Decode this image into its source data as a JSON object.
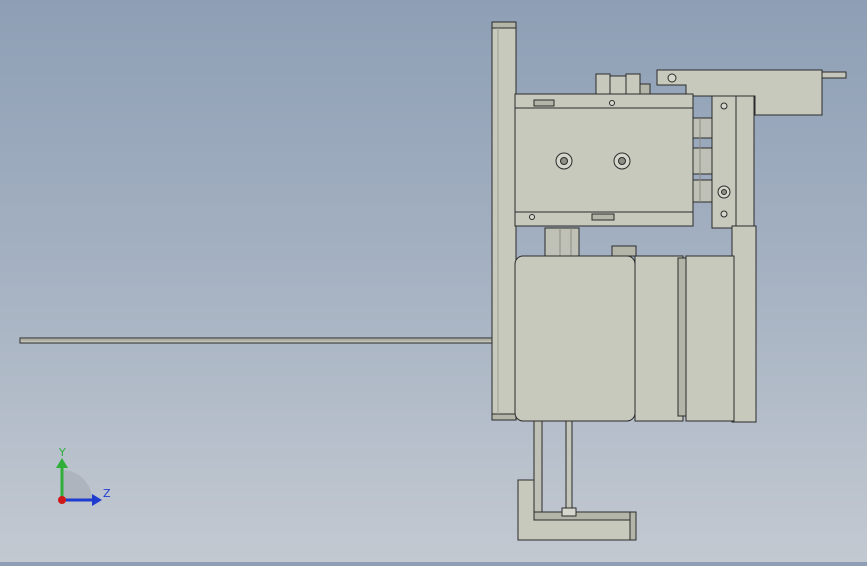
{
  "viewport": {
    "background_top": "#8e9fb5",
    "background_bottom": "#c3c9d1",
    "part_color": "#c8c9bd",
    "part_shade": "#b4b5a9",
    "edge_color": "#2b2b2b"
  },
  "triad": {
    "y_label": "Y",
    "z_label": "Z",
    "y_color": "#2fae3a",
    "z_color": "#1e3ccf",
    "x_color": "#d01818"
  }
}
